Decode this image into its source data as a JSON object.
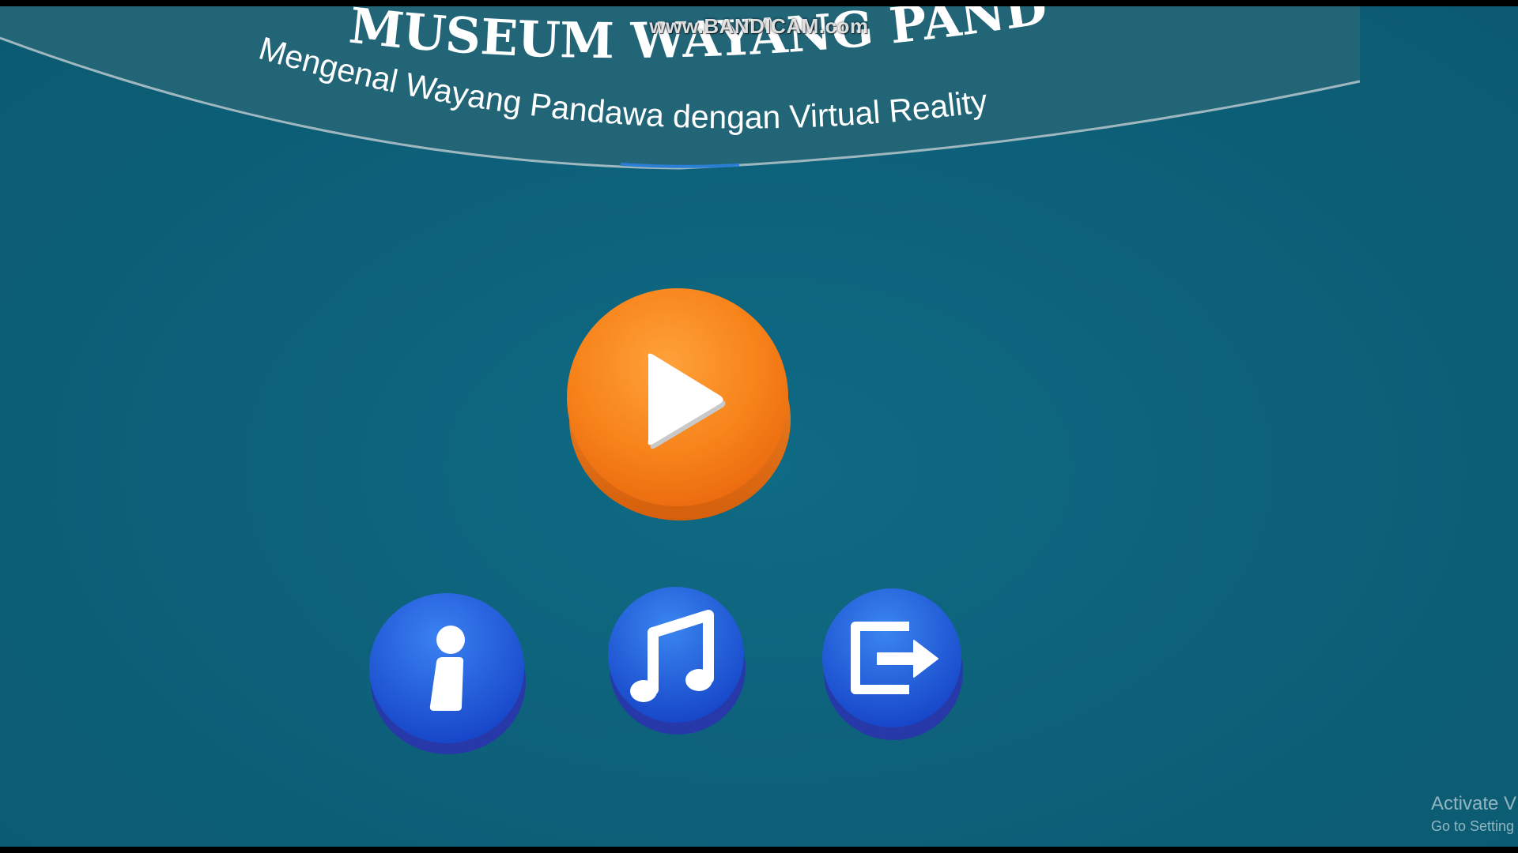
{
  "banner": {
    "title": "MUSEUM WAYANG PANDAWA",
    "subtitle": "Mengenal Wayang Pandawa dengan Virtual Reality"
  },
  "watermark": "www.BANDICAM.com",
  "menu": {
    "play_icon": "play-icon",
    "info_icon": "info-icon",
    "music_icon": "music-note-icon",
    "exit_icon": "exit-icon"
  },
  "windows_notice": {
    "line1": "Activate V",
    "line2": "Go to Setting"
  },
  "colors": {
    "background": "#0d6079",
    "banner": "#216577",
    "play_button": "#f7821a",
    "small_buttons": "#1d56d6"
  }
}
